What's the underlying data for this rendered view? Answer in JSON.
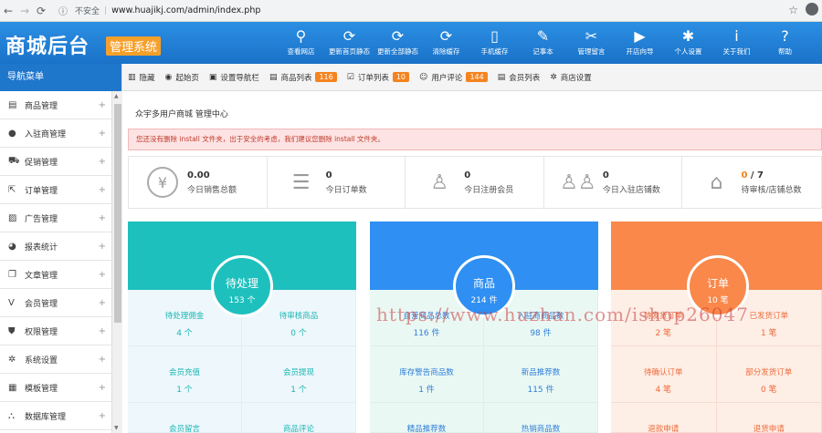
{
  "browser": {
    "back": "←",
    "forward": "→",
    "reload": "⟳",
    "insecure_label": "不安全",
    "url": "www.huajikj.com/admin/index.php"
  },
  "header": {
    "logo": "商城后台",
    "logo_tag": "管理系统",
    "nav": [
      {
        "icon": "⚲",
        "label": "查看网店",
        "icon_name": "search-icon"
      },
      {
        "icon": "⟳",
        "label": "更新首页静态",
        "icon_name": "refresh-icon"
      },
      {
        "icon": "⟳",
        "label": "更新全部静态",
        "icon_name": "refresh-icon"
      },
      {
        "icon": "⟳",
        "label": "清除缓存",
        "icon_name": "refresh-icon"
      },
      {
        "icon": "▯",
        "label": "手机缓存",
        "icon_name": "phone-icon"
      },
      {
        "icon": "✎",
        "label": "记事本",
        "icon_name": "note-icon"
      },
      {
        "icon": "✂",
        "label": "管理留言",
        "icon_name": "wrench-icon"
      },
      {
        "icon": "▶",
        "label": "开店向导",
        "icon_name": "play-icon"
      },
      {
        "icon": "✱",
        "label": "个人设置",
        "icon_name": "gear-icon"
      },
      {
        "icon": "i",
        "label": "关于我们",
        "icon_name": "info-icon"
      },
      {
        "icon": "?",
        "label": "帮助",
        "icon_name": "help-icon"
      }
    ]
  },
  "sidebar": {
    "title": "导航菜单",
    "items": [
      {
        "icon": "▤",
        "label": "商品管理"
      },
      {
        "icon": "●",
        "label": "入驻商管理"
      },
      {
        "icon": "⛟",
        "label": "促销管理"
      },
      {
        "icon": "⇱",
        "label": "订单管理"
      },
      {
        "icon": "▨",
        "label": "广告管理"
      },
      {
        "icon": "◕",
        "label": "报表统计"
      },
      {
        "icon": "❐",
        "label": "文章管理"
      },
      {
        "icon": "V",
        "label": "会员管理"
      },
      {
        "icon": "⛊",
        "label": "权限管理"
      },
      {
        "icon": "✲",
        "label": "系统设置"
      },
      {
        "icon": "▦",
        "label": "模板管理"
      },
      {
        "icon": "⛬",
        "label": "数据库管理"
      }
    ],
    "plus": "+"
  },
  "toolbar": {
    "items": [
      {
        "icon": "▥",
        "label": "隐藏",
        "badge": ""
      },
      {
        "icon": "◉",
        "label": "起始页",
        "badge": ""
      },
      {
        "icon": "▣",
        "label": "设置导航栏",
        "badge": ""
      },
      {
        "icon": "▤",
        "label": "商品列表",
        "badge": "116"
      },
      {
        "icon": "☑",
        "label": "订单列表",
        "badge": "10"
      },
      {
        "icon": "☺",
        "label": "用户评论",
        "badge": "144"
      },
      {
        "icon": "▤",
        "label": "会员列表",
        "badge": ""
      },
      {
        "icon": "✲",
        "label": "商店设置",
        "badge": ""
      }
    ]
  },
  "main": {
    "breadcrumb": "众宇多用户商城 管理中心",
    "alert": "您还没有删除 install 文件夹，出于安全的考虑，我们建议您删除 install 文件夹。",
    "stats": [
      {
        "icon": "¥",
        "value": "0.00",
        "label": "今日销售总额"
      },
      {
        "icon": "☰",
        "value": "0",
        "label": "今日订单数"
      },
      {
        "icon": "♙",
        "value": "0",
        "label": "今日注册会员"
      },
      {
        "icon": "♙♙",
        "value": "0",
        "label": "今日入驻店铺数"
      },
      {
        "icon": "⌂",
        "value_hl": "0",
        "value_rest": " / 7",
        "label": "待审核/店铺总数"
      }
    ]
  },
  "cards": [
    {
      "title": "待处理",
      "count": "153 个",
      "cells": [
        {
          "label": "待处理佣金",
          "value": "4 个"
        },
        {
          "label": "待审核商品",
          "value": "0 个"
        },
        {
          "label": "会员充值",
          "value": "1 个"
        },
        {
          "label": "会员提现",
          "value": "1 个"
        },
        {
          "label": "会员留言",
          "value": ""
        },
        {
          "label": "商品评论",
          "value": ""
        }
      ]
    },
    {
      "title": "商品",
      "count": "214 件",
      "cells": [
        {
          "label": "自营商品总数",
          "value": "116 件"
        },
        {
          "label": "入驻商商品数",
          "value": "98 件"
        },
        {
          "label": "库存警告商品数",
          "value": "1 件"
        },
        {
          "label": "新品推荐数",
          "value": "115 件"
        },
        {
          "label": "精品推荐数",
          "value": ""
        },
        {
          "label": "热销商品数",
          "value": ""
        }
      ]
    },
    {
      "title": "订单",
      "count": "10 笔",
      "cells": [
        {
          "label": "待发货订单",
          "value": "2 笔"
        },
        {
          "label": "已发货订单",
          "value": "1 笔"
        },
        {
          "label": "待确认订单",
          "value": "4 笔"
        },
        {
          "label": "部分发货订单",
          "value": "0 笔"
        },
        {
          "label": "退款申请",
          "value": ""
        },
        {
          "label": "退货申请",
          "value": ""
        }
      ]
    }
  ],
  "watermark": "https://www.huzhan.com/ishop26047"
}
